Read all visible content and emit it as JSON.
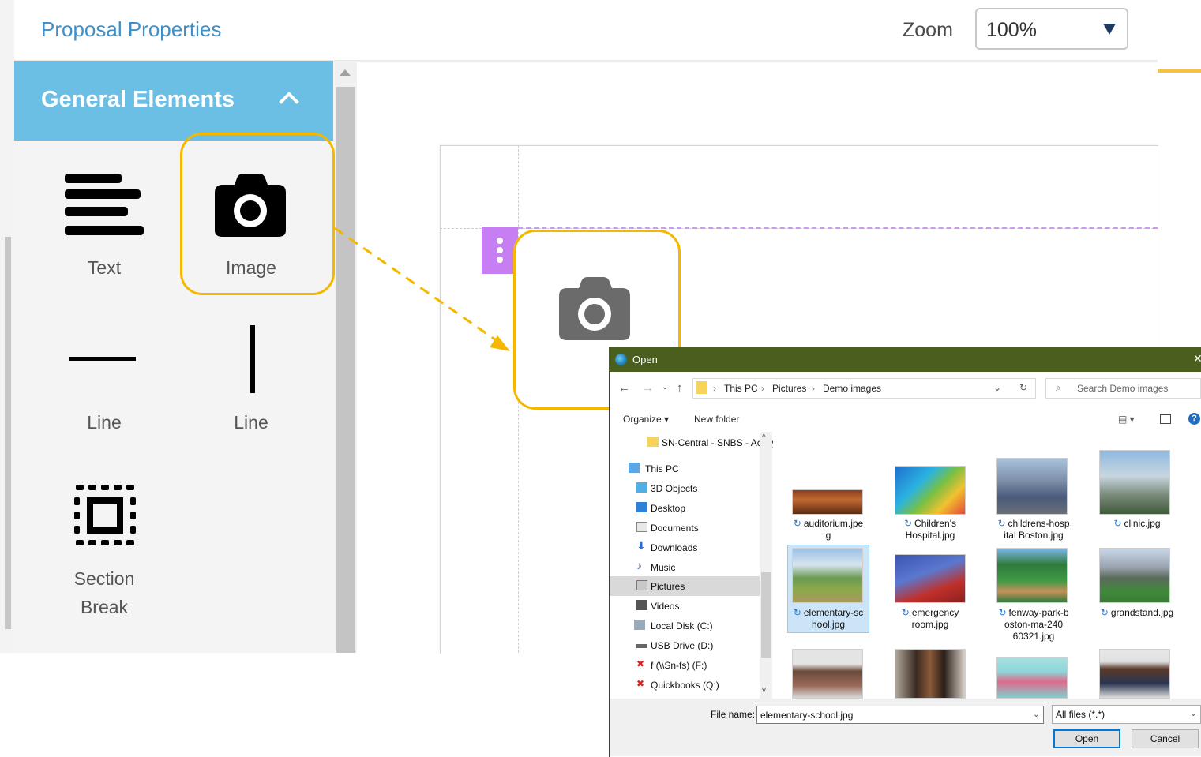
{
  "header": {
    "title": "Proposal Properties",
    "zoom_label": "Zoom",
    "zoom_value": "100%"
  },
  "panel": {
    "title": "General Elements",
    "elements": [
      "Text",
      "Image",
      "Line",
      "Line",
      "Section",
      "Break"
    ]
  },
  "dialog": {
    "title": "Open",
    "close": "✕",
    "breadcrumb": [
      "This PC",
      "Pictures",
      "Demo images"
    ],
    "search_placeholder": "Search Demo images",
    "organize": "Organize",
    "new_folder": "New folder",
    "nav": [
      "SN-Central - SNBS - Acuity",
      "This PC",
      "3D Objects",
      "Desktop",
      "Documents",
      "Downloads",
      "Music",
      "Pictures",
      "Videos",
      "Local Disk (C:)",
      "USB Drive (D:)",
      "f (\\\\Sn-fs) (F:)",
      "Quickbooks (Q:)"
    ],
    "files": [
      [
        "auditorium.jpe",
        "g"
      ],
      [
        "Children's",
        "Hospital.jpg"
      ],
      [
        "childrens-hosp",
        "ital Boston.jpg"
      ],
      [
        "clinic.jpg"
      ],
      [
        "elementary-sc",
        "hool.jpg"
      ],
      [
        "emergency",
        "room.jpg"
      ],
      [
        "fenway-park-b",
        "oston-ma-240",
        "60321.jpg"
      ],
      [
        "grandstand.jpg"
      ]
    ],
    "file_name_label": "File name:",
    "file_name_value": "elementary-school.jpg",
    "file_type": "All files (*.*)",
    "open_button": "Open",
    "cancel_button": "Cancel"
  },
  "colors": {
    "accent_blue": "#6cbfe4",
    "highlight": "#f5b800",
    "section_purple": "#c77ef3",
    "dialog_titlebar": "#4a5e1e"
  }
}
